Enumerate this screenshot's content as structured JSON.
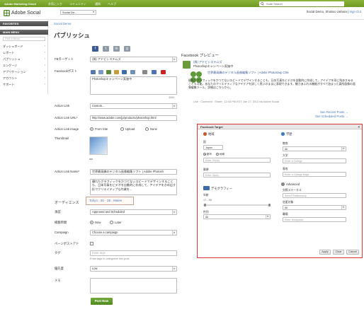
{
  "topbar": {
    "nav": [
      "Adobe Marketing Cloud",
      "お気に入り",
      "コミュニティ",
      "通知",
      "ヘルプ"
    ],
    "search_placeholder": "Suite Search"
  },
  "header": {
    "brand": "Adobe Social",
    "account": "Social De...",
    "user_line1": "Social Demo, Shotaro Uehara",
    "user_line2": "Sign Out"
  },
  "sidebar": {
    "favorites": "FAVORITES",
    "main_menu": "MAIN MENU",
    "search_placeholder": "Find in Menu",
    "items": [
      "ダッシュボード",
      "レポート",
      "パブリッシュ",
      "エンゲージ",
      "アプリケーション",
      "アカウント",
      "サポート"
    ]
  },
  "breadcrumb": "Social Demo",
  "page_title": "パブリッシュ",
  "form": {
    "fb_target_label": "FBターゲット",
    "fb_target_value": "(株) アドビシステムズ",
    "fb_post_label": "Facebookポスト",
    "fb_post_text": "Photoshopキャンペーン実施中",
    "char_count": "3580",
    "action_link_label": "Action Link",
    "action_link_value": "Custom...",
    "action_link_url_label": "Action Link URL*",
    "action_link_url_value": "http://www.adobe.com/jp/products/photoshop.html",
    "action_link_image_label": "Action Link Image",
    "image_options": [
      "From Site",
      "Upload",
      "None"
    ],
    "thumbnail_label": "Thumbnail",
    "action_link_name_label": "Action Link Name*",
    "action_link_name_value": "世界最高峰のデジタル画像編集ソフト | Adobe Photosh",
    "description_text": "優れたグラフィックをかつてないスピードでデザインすることも、日本写真をビデオを自動的に作成して、アイデアをきめ出す形でクリエイティブな作業を...",
    "audience_label": "オーディエンス",
    "approval_label": "承認",
    "approval_value": "Approved and Scheduled",
    "schedule_label": "掲載時間",
    "schedule_options": [
      "Now",
      "Later"
    ],
    "campaign_label": "Campaign",
    "campaign_value": "Choose a campaign",
    "pagepost_label": "ページポストアド",
    "tags_label": "タグ",
    "tags_placeholder": "Enter tags",
    "tags_help": "Enter tags to categorize this post.",
    "priority_label": "優先度",
    "priority_value": "Low",
    "memo_label": "メモ",
    "post_button": "Post Now"
  },
  "tooltip": "Tokyo ; 20 - 35 ; Males",
  "preview": {
    "title": "Facebook プレビュー",
    "page_name": "(株) アドビシステムズ",
    "post_text": "Photoshopキャンペーン実施中",
    "link_title": "世界最高峰のデジタル画像編集ソフト | Adobe Photoshop CS6",
    "link_desc": "優れたグラフィックをかつてないスピードでデザインすることも、日本写真をビデオを自動的に作成して、アイデアを形に残あすみることも可能。あなたのクリエイティブなアイデアを詳しく思いのままに表現できます。魅力あふれる機能がすべて詰まった真所画像の画像編集ツール。詳細はこちらから。",
    "meta": "Like · Comment · Share · 12:44 PM EST, Jan 17, 2013 via Adobe Social",
    "recent_link": "See Recent Posts →",
    "scheduled_link": "See Scheduled Posts →"
  },
  "modal": {
    "title": "Facebook Target",
    "location_header": "地域",
    "country_label": "国",
    "country_value": "Japan",
    "city_label": "都市",
    "city_placeholder": "Enter City(s)",
    "region_label": "地域",
    "region_placeholder": "Enter Region",
    "zip_label": "郵便",
    "zip_placeholder": "Enter Zip(s)",
    "demo_header": "デモグラフィー",
    "age_label": "年齢",
    "age_value": "17 - 65",
    "gender_label": "性別",
    "gender_value": "All",
    "edu_header": "学歴",
    "edu_status_label": "教育",
    "edu_status_value": "All",
    "college_label": "大学",
    "college_placeholder": "Enter a College",
    "major_label": "専攻",
    "major_placeholder": "Enter a College Major",
    "advanced_header": "Advanced",
    "relation_label": "交際ステータス",
    "relation_placeholder": "Select Relationship",
    "interested_label": "恋愛対象",
    "interested_value": "All",
    "workplace_label": "職場",
    "workplace_placeholder": "Enter Workplace",
    "apply": "Apply",
    "clear": "Clear",
    "cancel": "Cancel"
  },
  "colors": {
    "topbar": "#7aa82e",
    "accent_link": "#4a7bb7",
    "facebook": "#3b5998",
    "post_button": "#5f9a26",
    "modal_border": "#dd3333"
  }
}
